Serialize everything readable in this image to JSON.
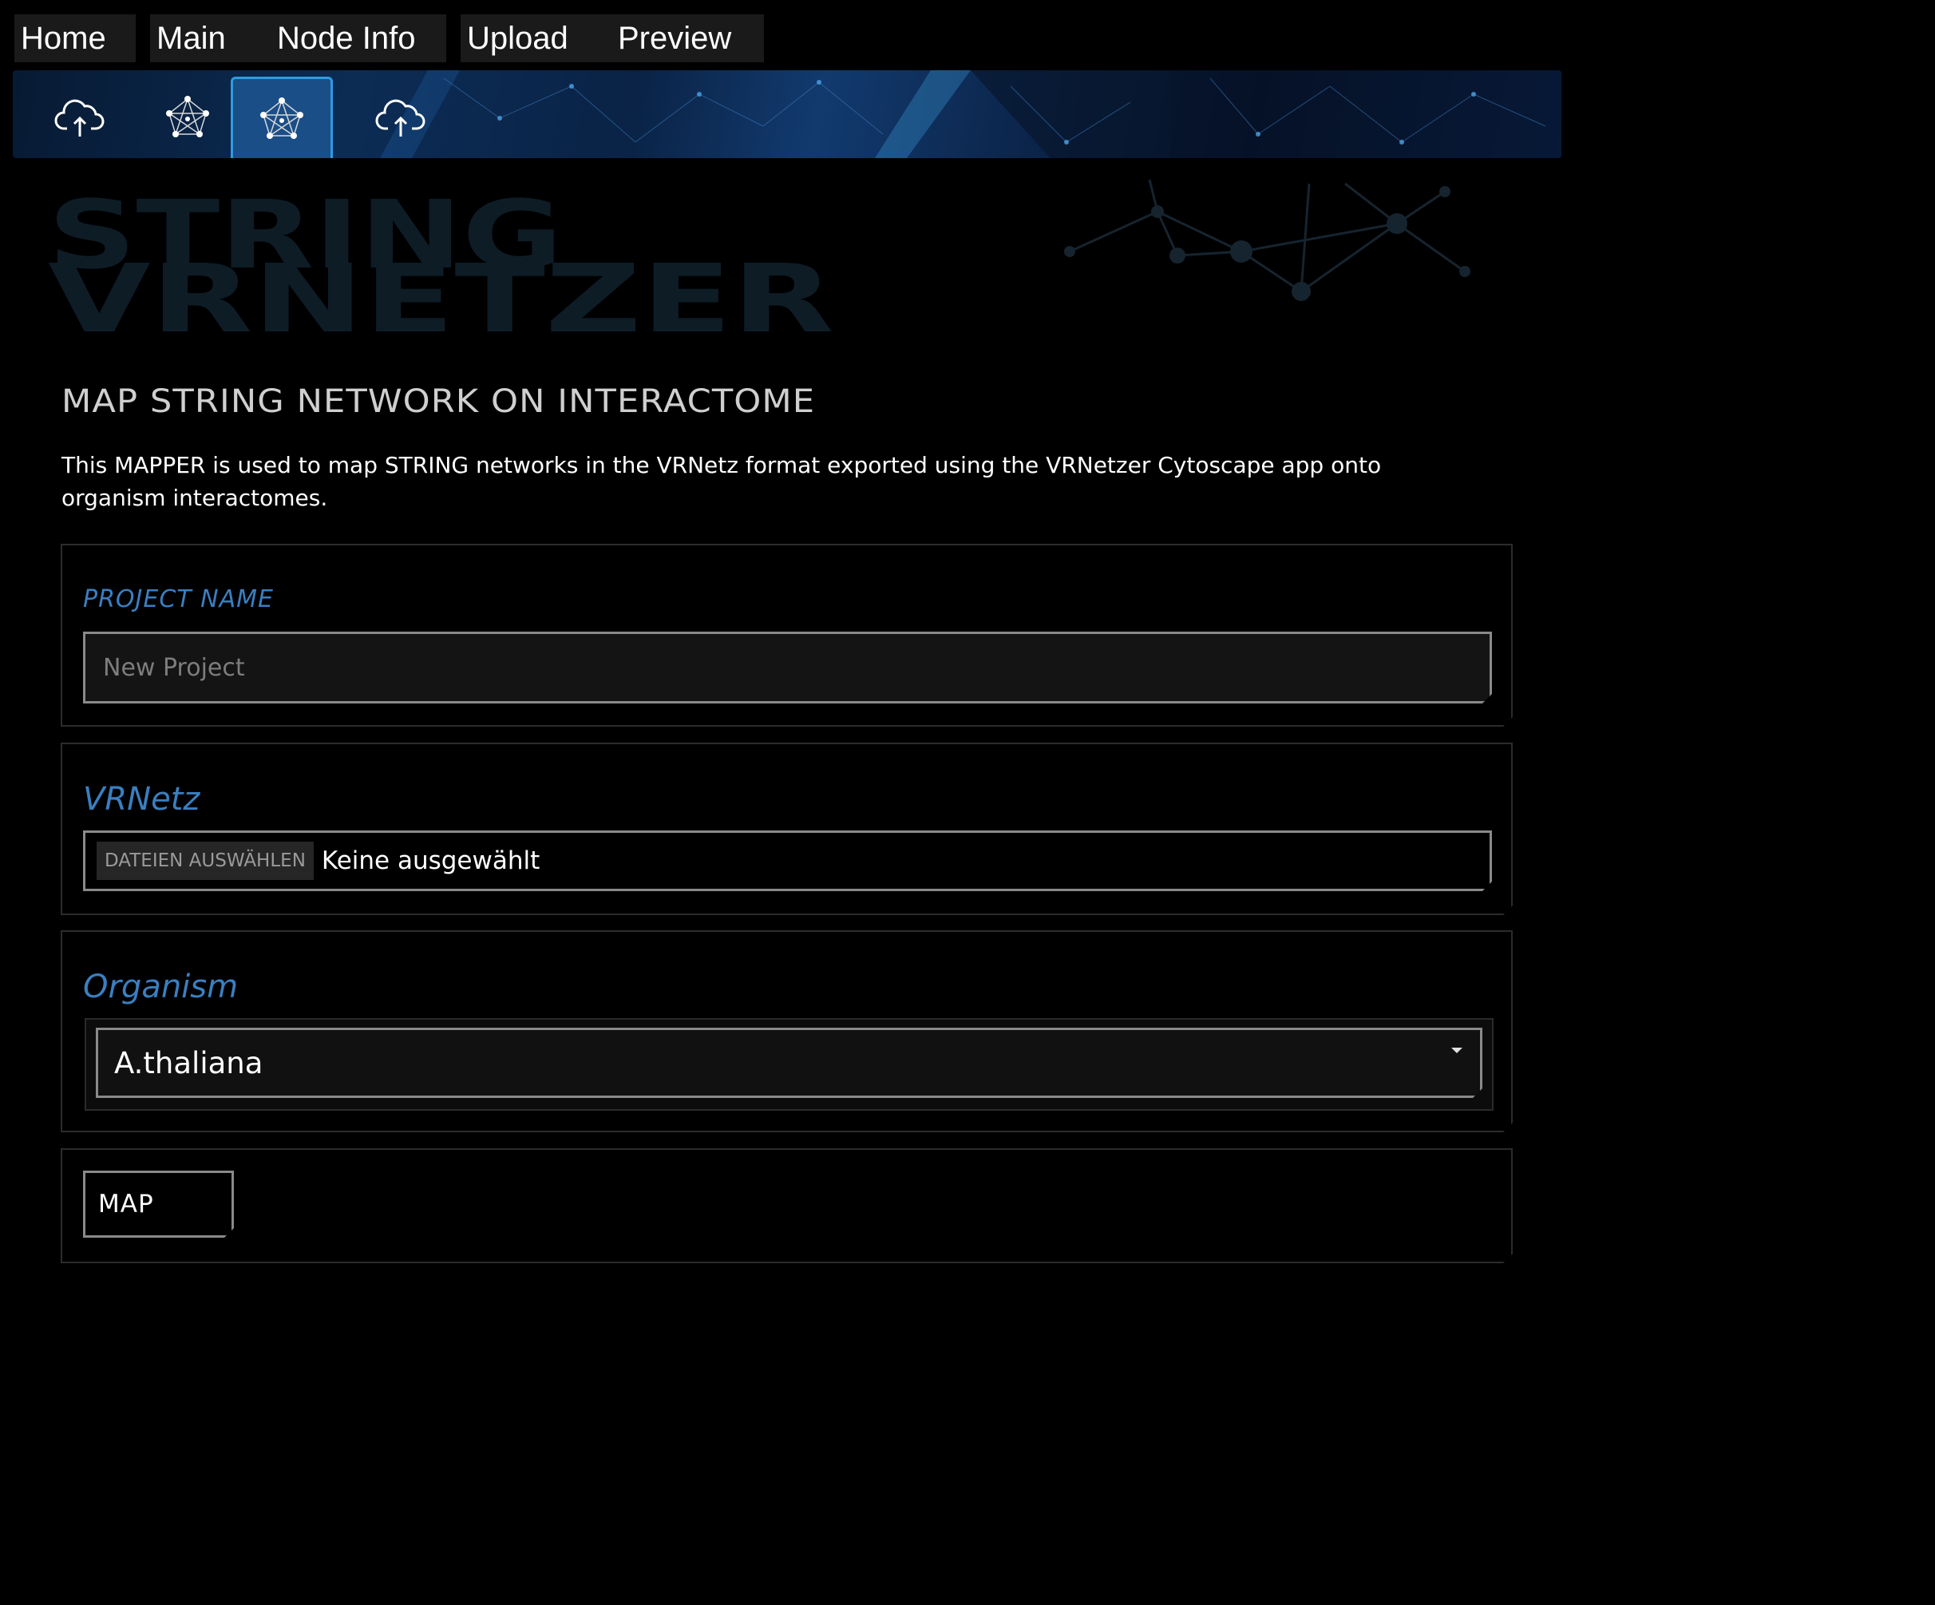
{
  "nav": {
    "tabs": [
      {
        "label": "Home"
      },
      {
        "label": "Main"
      },
      {
        "label": "Node Info"
      },
      {
        "label": "Upload"
      },
      {
        "label": "Preview"
      }
    ]
  },
  "toolbar": {
    "buttons": [
      {
        "icon": "cloud-upload-icon",
        "active": false
      },
      {
        "icon": "network-icon",
        "active": false
      },
      {
        "icon": "network-icon",
        "active": true
      },
      {
        "icon": "cloud-upload-icon",
        "active": false
      }
    ]
  },
  "logo": {
    "line1": "STRING",
    "line2": "VRNETZER"
  },
  "page": {
    "title": "MAP STRING NETWORK ON INTERACTOME",
    "description": "This MAPPER is used to map STRING networks in the VRNetz format exported using the VRNetzer Cytoscape app onto organism interactomes."
  },
  "form": {
    "project_name": {
      "label": "PROJECT NAME",
      "placeholder": "New Project",
      "value": ""
    },
    "vrnetz": {
      "label": "VRNetz",
      "button_label": "DATEIEN AUSWÄHLEN",
      "status": "Keine ausgewählt"
    },
    "organism": {
      "label": "Organism",
      "selected": "A.thaliana"
    },
    "submit_label": "MAP"
  },
  "colors": {
    "background": "#000000",
    "accent_label": "#3a7fc0",
    "active_toolbar": "#1a4e86",
    "active_toolbar_border": "#2f9be0",
    "logo_text": "#0e1c26"
  }
}
